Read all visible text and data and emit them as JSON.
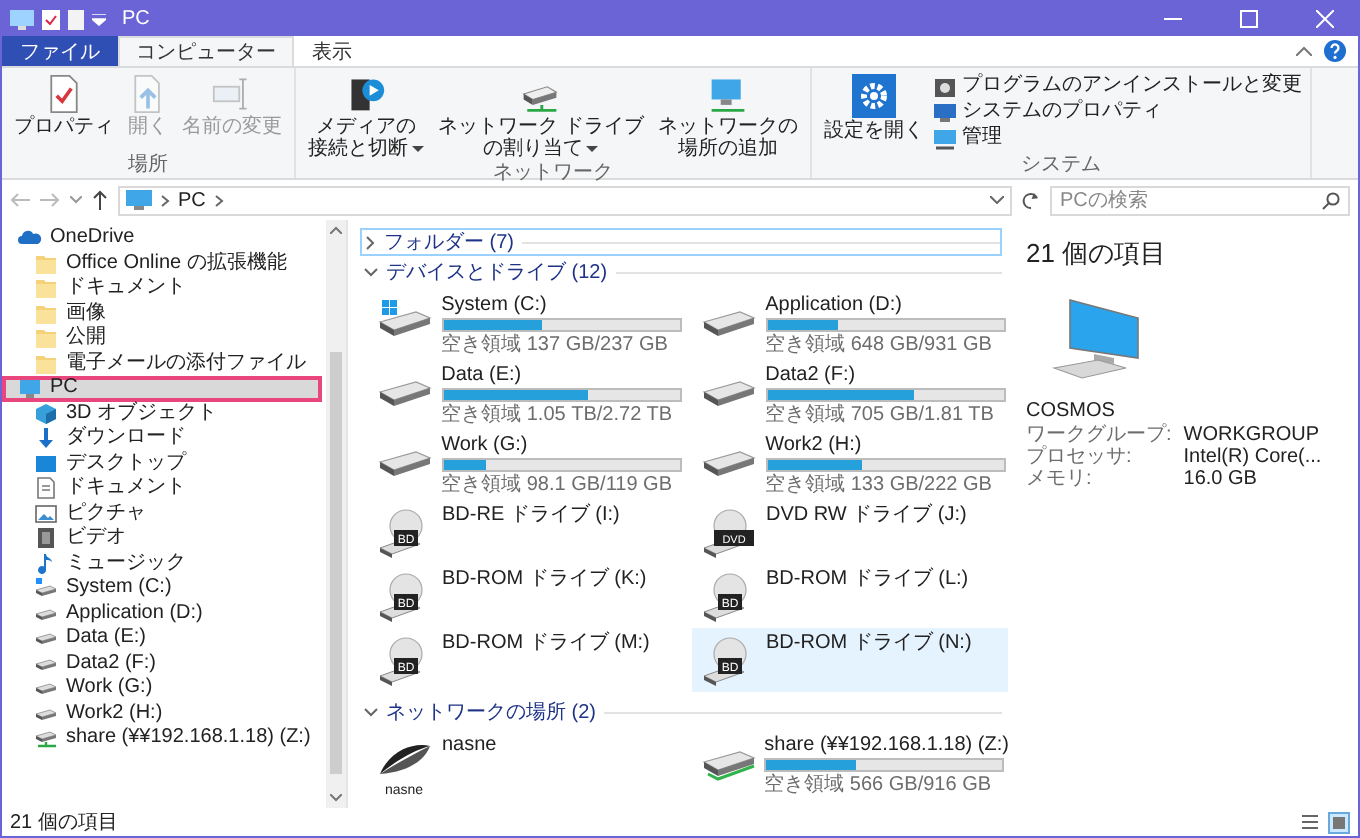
{
  "window": {
    "title": "PC"
  },
  "ribbon": {
    "tabs": [
      {
        "label": "ファイル",
        "kind": "file",
        "selected": false
      },
      {
        "label": "コンピューター",
        "kind": "tab",
        "selected": true
      },
      {
        "label": "表示",
        "kind": "tab",
        "selected": false
      }
    ],
    "groups": [
      {
        "label": "場所",
        "buttons": [
          {
            "label": "プロパティ",
            "kind": "properties",
            "disabled": false
          },
          {
            "label": "開く",
            "kind": "open",
            "disabled": true
          },
          {
            "label": "名前の変更",
            "kind": "rename",
            "disabled": true
          }
        ]
      },
      {
        "label": "ネットワーク",
        "buttons": [
          {
            "lines": [
              "メディアの",
              "接続と切断"
            ],
            "kind": "media",
            "disabled": false,
            "dropdown": true
          },
          {
            "lines": [
              "ネットワーク ドライブ",
              "の割り当て"
            ],
            "kind": "map-drive",
            "disabled": false,
            "dropdown": true
          },
          {
            "lines": [
              "ネットワークの",
              "場所の追加"
            ],
            "kind": "add-location",
            "disabled": false,
            "dropdown": false
          }
        ]
      },
      {
        "label": "システム",
        "buttons": [
          {
            "label": "設定を開く",
            "kind": "settings",
            "disabled": false
          }
        ],
        "small_buttons": [
          {
            "label": "プログラムのアンインストールと変更",
            "kind": "uninstall"
          },
          {
            "label": "システムのプロパティ",
            "kind": "system-properties"
          },
          {
            "label": "管理",
            "kind": "manage"
          }
        ]
      }
    ]
  },
  "address": {
    "path": [
      "PC"
    ],
    "search": {
      "placeholder": "PCの検索"
    }
  },
  "nav": {
    "items": [
      {
        "label": "OneDrive",
        "kind": "cloud",
        "selected": false,
        "callout": false,
        "children": [
          {
            "label": "Office Online の拡張機能",
            "kind": "folder",
            "selected": false,
            "callout": false
          },
          {
            "label": "ドキュメント",
            "kind": "folder",
            "selected": false,
            "callout": false
          },
          {
            "label": "画像",
            "kind": "folder",
            "selected": false,
            "callout": false
          },
          {
            "label": "公開",
            "kind": "folder",
            "selected": false,
            "callout": false
          },
          {
            "label": "電子メールの添付ファイル",
            "kind": "folder",
            "selected": false,
            "callout": false
          }
        ]
      },
      {
        "label": "PC",
        "kind": "pc",
        "selected": true,
        "callout": true,
        "children": [
          {
            "label": "3D オブジェクト",
            "kind": "objects3d",
            "selected": false,
            "callout": false
          },
          {
            "label": "ダウンロード",
            "kind": "download",
            "selected": false,
            "callout": false
          },
          {
            "label": "デスクトップ",
            "kind": "desktop",
            "selected": false,
            "callout": false
          },
          {
            "label": "ドキュメント",
            "kind": "document",
            "selected": false,
            "callout": false
          },
          {
            "label": "ピクチャ",
            "kind": "picture",
            "selected": false,
            "callout": false
          },
          {
            "label": "ビデオ",
            "kind": "video",
            "selected": false,
            "callout": false
          },
          {
            "label": "ミュージック",
            "kind": "music",
            "selected": false,
            "callout": false
          },
          {
            "label": "System (C:)",
            "kind": "system-drive",
            "selected": false,
            "callout": false
          },
          {
            "label": "Application (D:)",
            "kind": "drive",
            "selected": false,
            "callout": false
          },
          {
            "label": "Data (E:)",
            "kind": "drive",
            "selected": false,
            "callout": false
          },
          {
            "label": "Data2 (F:)",
            "kind": "drive",
            "selected": false,
            "callout": false
          },
          {
            "label": "Work (G:)",
            "kind": "drive",
            "selected": false,
            "callout": false
          },
          {
            "label": "Work2 (H:)",
            "kind": "drive",
            "selected": false,
            "callout": false
          },
          {
            "label": "share (¥¥192.168.1.18) (Z:)",
            "kind": "network-drive",
            "selected": false,
            "callout": false
          }
        ]
      }
    ]
  },
  "sections": [
    {
      "title": "フォルダー (7)",
      "expanded": false
    },
    {
      "title": "デバイスとドライブ (12)",
      "expanded": true,
      "items": [
        {
          "kind": "system-disk",
          "name": "System (C:)",
          "free": "空き領域 137 GB/237 GB",
          "level": 0.42,
          "selected": false
        },
        {
          "kind": "disk",
          "name": "Application (D:)",
          "free": "空き領域 648 GB/931 GB",
          "level": 0.3,
          "selected": false
        },
        {
          "kind": "disk",
          "name": "Data (E:)",
          "free": "空き領域 1.05 TB/2.72 TB",
          "level": 0.61,
          "selected": false
        },
        {
          "kind": "disk",
          "name": "Data2 (F:)",
          "free": "空き領域 705 GB/1.81 TB",
          "level": 0.62,
          "selected": false
        },
        {
          "kind": "disk",
          "name": "Work (G:)",
          "free": "空き領域 98.1 GB/119 GB",
          "level": 0.18,
          "selected": false
        },
        {
          "kind": "disk",
          "name": "Work2 (H:)",
          "free": "空き領域 133 GB/222 GB",
          "level": 0.4,
          "selected": false
        },
        {
          "kind": "optical",
          "name": "BD-RE ドライブ (I:)",
          "disc": "BD",
          "selected": false
        },
        {
          "kind": "optical",
          "name": "DVD RW ドライブ (J:)",
          "disc": "DVD",
          "selected": false
        },
        {
          "kind": "optical",
          "name": "BD-ROM ドライブ (K:)",
          "disc": "BD",
          "selected": false
        },
        {
          "kind": "optical",
          "name": "BD-ROM ドライブ (L:)",
          "disc": "BD",
          "selected": false
        },
        {
          "kind": "optical",
          "name": "BD-ROM ドライブ (M:)",
          "disc": "BD",
          "selected": false
        },
        {
          "kind": "optical",
          "name": "BD-ROM ドライブ (N:)",
          "disc": "BD",
          "selected": true
        }
      ]
    },
    {
      "title": "ネットワークの場所 (2)",
      "expanded": true,
      "items": [
        {
          "kind": "media-server",
          "name": "nasne",
          "logo": "nasne",
          "selected": false
        },
        {
          "kind": "network-disk",
          "name": "share (¥¥192.168.1.18) (Z:)",
          "free": "空き領域 566 GB/916 GB",
          "level": 0.38,
          "selected": false
        }
      ]
    }
  ],
  "details": {
    "count": "21 個の項目",
    "computer": "COSMOS",
    "properties": [
      {
        "key": "ワークグループ:",
        "value": "WORKGROUP"
      },
      {
        "key": "プロセッサ:",
        "value": "Intel(R) Core(..."
      },
      {
        "key": "メモリ:",
        "value": "16.0 GB"
      }
    ]
  },
  "status_bar": {
    "text": "21 個の項目"
  }
}
